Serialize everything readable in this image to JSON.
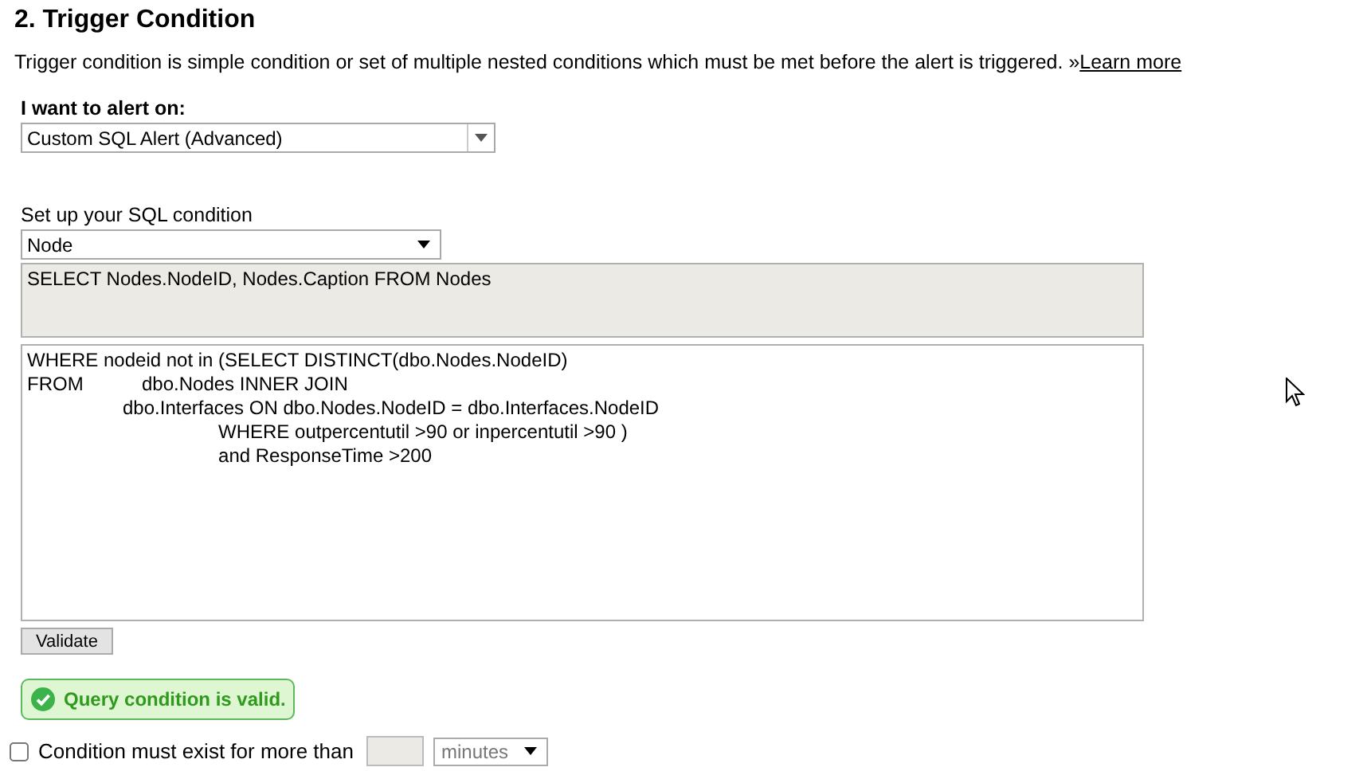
{
  "heading": "2. Trigger Condition",
  "description": {
    "text": "Trigger condition is simple condition or set of multiple nested conditions which must be met before the alert is triggered.",
    "link_prefix": "»",
    "link": "Learn more"
  },
  "alert_on": {
    "label": "I want to alert on:",
    "value": "Custom SQL Alert (Advanced)"
  },
  "sql": {
    "label": "Set up your SQL condition",
    "object_select": "Node",
    "select_clause": "SELECT Nodes.NodeID, Nodes.Caption FROM Nodes",
    "where_lines": [
      "WHERE nodeid not in (SELECT DISTINCT(dbo.Nodes.NodeID)",
      "FROM           dbo.Nodes INNER JOIN",
      "                  dbo.Interfaces ON dbo.Nodes.NodeID = dbo.Interfaces.NodeID",
      "                                    WHERE outpercentutil >90 or inpercentutil >90 )",
      "                                    and ResponseTime >200"
    ]
  },
  "validate_button": "Validate",
  "validation": {
    "valid": true,
    "message": "Query condition is valid."
  },
  "duration": {
    "checked": false,
    "label": "Condition must exist for more than",
    "unit": "minutes"
  }
}
